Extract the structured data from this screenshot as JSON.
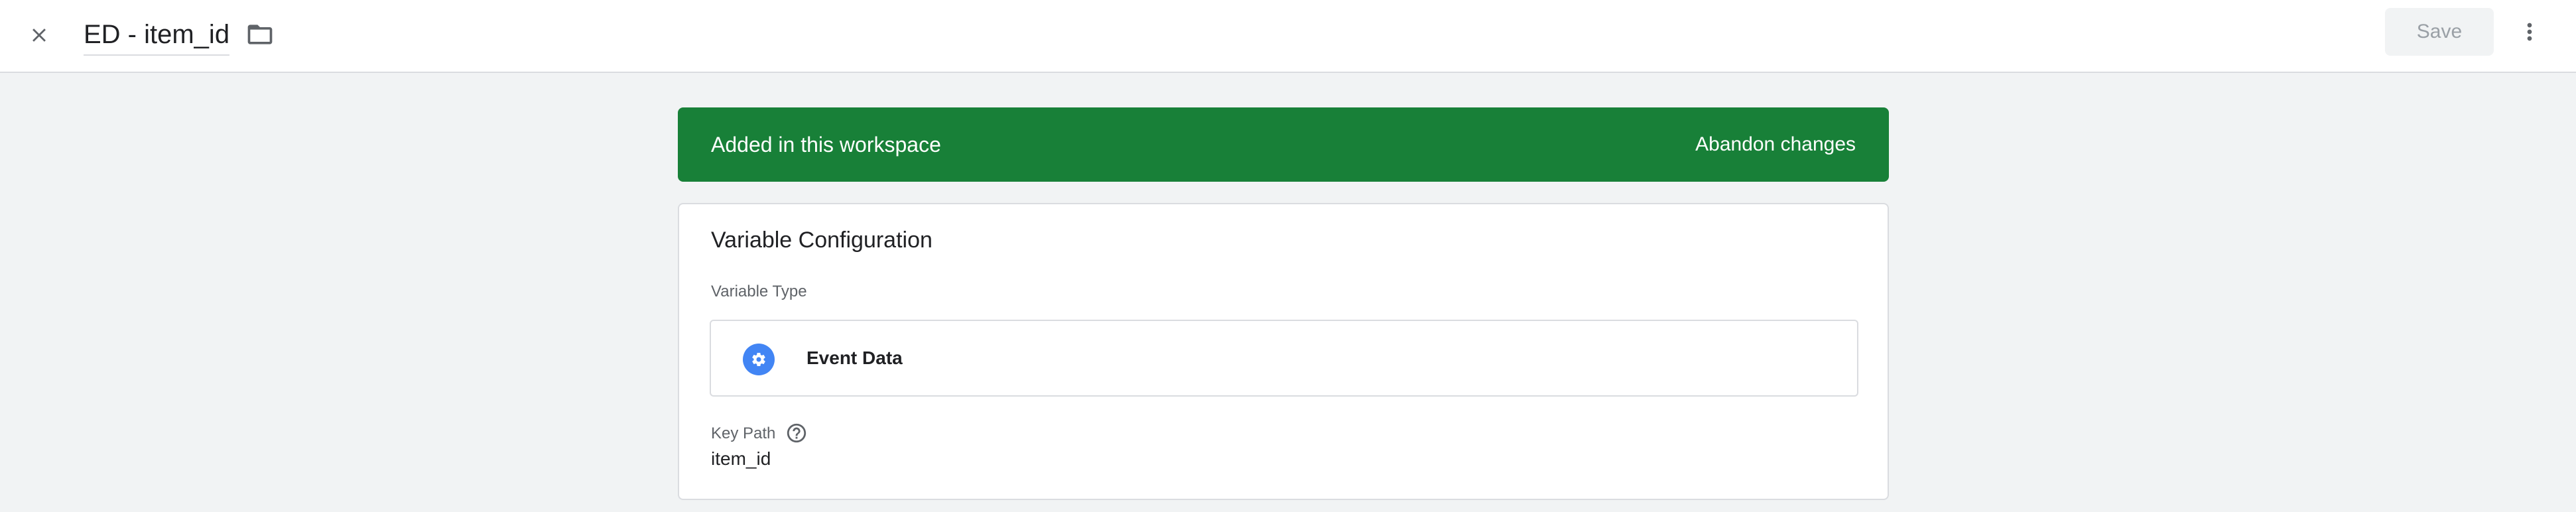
{
  "header": {
    "title": "ED - item_id",
    "save_label": "Save",
    "icons": {
      "close": "close-icon",
      "folder": "folder-icon",
      "more": "more-vert-icon"
    }
  },
  "banner": {
    "text": "Added in this workspace",
    "action_label": "Abandon changes",
    "color": "#188038"
  },
  "variable_config": {
    "title": "Variable Configuration",
    "type_label": "Variable Type",
    "type_name": "Event Data",
    "type_icon": "gear-icon",
    "type_icon_color": "#4285f4",
    "key_path_label": "Key Path",
    "key_path_value": "item_id",
    "help_icon": "help-icon"
  }
}
